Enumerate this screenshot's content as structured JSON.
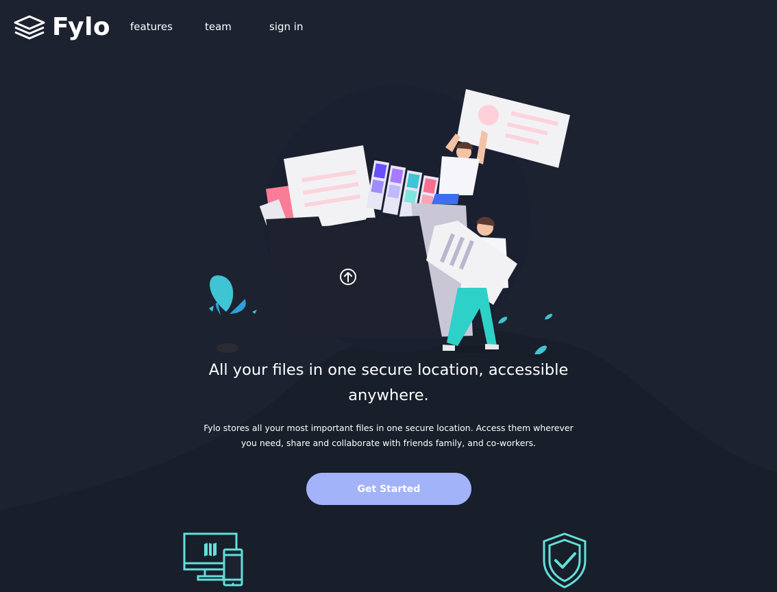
{
  "header": {
    "brand": "Fylo",
    "nav": [
      {
        "label": "features"
      },
      {
        "label": "team"
      },
      {
        "label": "sign in"
      }
    ]
  },
  "hero": {
    "headline": "All your files in one secure location, accessible anywhere.",
    "description": "Fylo stores all your most important files in one secure location. Access them wherever you need, share and collaborate with friends family, and co-workers.",
    "cta_label": "Get Started"
  },
  "icons": {
    "logo": "layers-logo-icon",
    "upload": "upload-arrow-icon",
    "feature_1": "devices-icon",
    "feature_2": "shield-check-icon"
  },
  "colors": {
    "background": "#1c2230",
    "background_curve": "#181e2a",
    "cta": "#a3b3fa",
    "accent_teal": "#62e0d9",
    "accent_pink": "#fa7d97"
  }
}
